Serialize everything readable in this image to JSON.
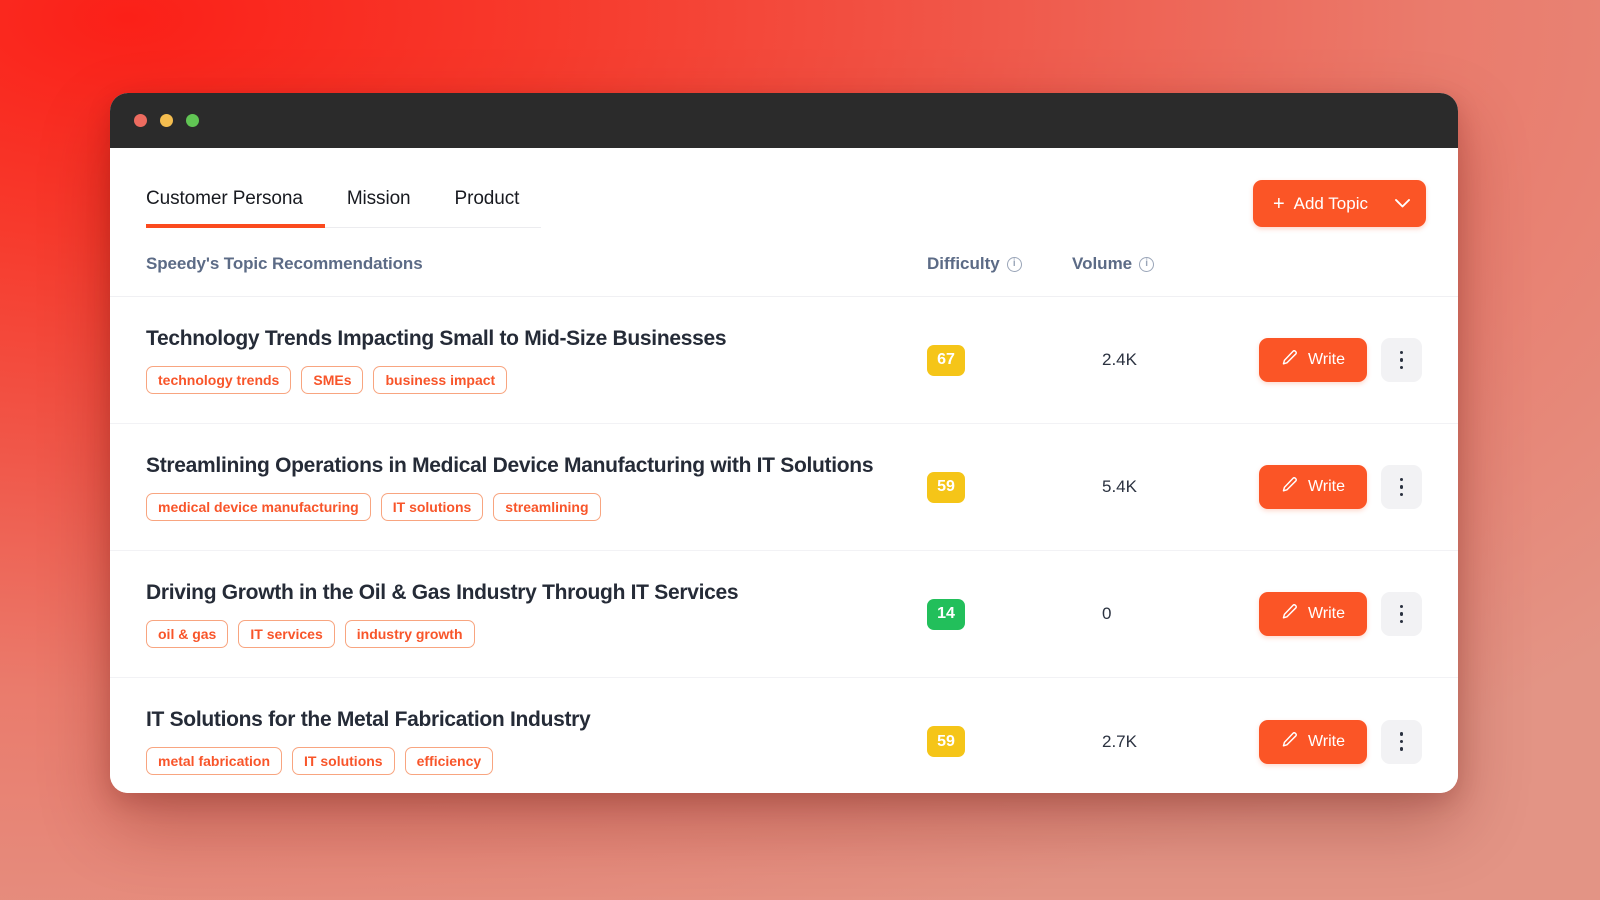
{
  "window": {
    "traffic_lights": [
      {
        "name": "close",
        "color": "#ed6b5f"
      },
      {
        "name": "minimize",
        "color": "#f4bd4f"
      },
      {
        "name": "maximize",
        "color": "#61c554"
      }
    ]
  },
  "colors": {
    "accent": "#fb5526",
    "accent_underline": "#fb4a1e",
    "tag_border": "#f8a580",
    "tag_text": "#f8552a",
    "header_text": "#5c6b86",
    "title_text": "#252b37",
    "difficulty_medium": "#f5c518",
    "difficulty_easy": "#22bf5b",
    "background_from": "#fb2018",
    "background_to": "#e39485"
  },
  "tabs": [
    {
      "label": "Customer Persona",
      "active": true
    },
    {
      "label": "Mission",
      "active": false
    },
    {
      "label": "Product",
      "active": false
    }
  ],
  "toolbar": {
    "add_topic_label": "Add Topic",
    "add_topic_plus": "+"
  },
  "list_header": {
    "title": "Speedy's Topic Recommendations",
    "difficulty_label": "Difficulty",
    "volume_label": "Volume",
    "info_glyph": "i"
  },
  "actions": {
    "write_label": "Write"
  },
  "rows": [
    {
      "title": "Technology Trends Impacting Small to Mid-Size Businesses",
      "tags": [
        "technology trends",
        "SMEs",
        "business impact"
      ],
      "difficulty": "67",
      "difficulty_color": "#f5c518",
      "volume": "2.4K"
    },
    {
      "title": "Streamlining Operations in Medical Device Manufacturing with IT Solutions",
      "tags": [
        "medical device manufacturing",
        "IT solutions",
        "streamlining"
      ],
      "difficulty": "59",
      "difficulty_color": "#f5c518",
      "volume": "5.4K"
    },
    {
      "title": "Driving Growth in the Oil & Gas Industry Through IT Services",
      "tags": [
        "oil & gas",
        "IT services",
        "industry growth"
      ],
      "difficulty": "14",
      "difficulty_color": "#22bf5b",
      "volume": "0"
    },
    {
      "title": "IT Solutions for the Metal Fabrication Industry",
      "tags": [
        "metal fabrication",
        "IT solutions",
        "efficiency"
      ],
      "difficulty": "59",
      "difficulty_color": "#f5c518",
      "volume": "2.7K"
    }
  ]
}
